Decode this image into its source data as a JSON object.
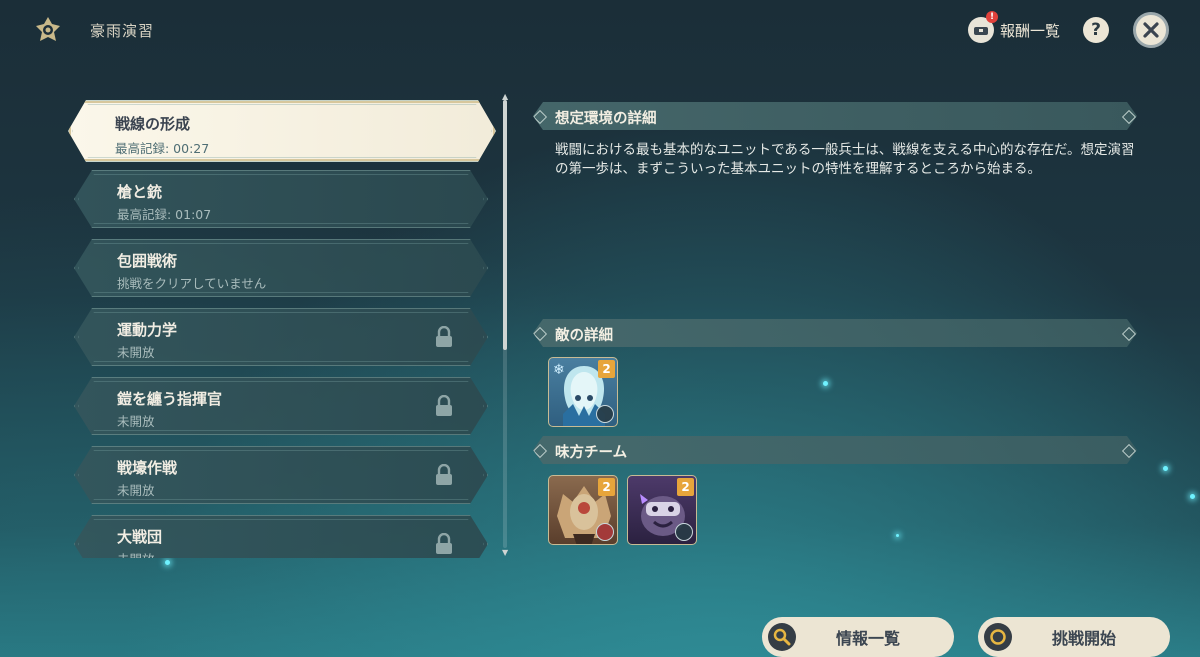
{
  "header": {
    "title": "豪雨演習",
    "rewards_label": "報酬一覧",
    "rewards_badge": "!",
    "help_label": "?"
  },
  "challenges": [
    {
      "name": "戦線の形成",
      "sub": "最高記録: 00:27",
      "state": "active"
    },
    {
      "name": "槍と銃",
      "sub": "最高記録: 01:07",
      "state": "cleared"
    },
    {
      "name": "包囲戦術",
      "sub": "挑戦をクリアしていません",
      "state": "open"
    },
    {
      "name": "運動力学",
      "sub": "未開放",
      "state": "locked"
    },
    {
      "name": "鎧を纏う指揮官",
      "sub": "未開放",
      "state": "locked"
    },
    {
      "name": "戦壕作戦",
      "sub": "未開放",
      "state": "locked"
    },
    {
      "name": "大戦団",
      "sub": "未開放",
      "state": "locked"
    }
  ],
  "details": {
    "env_heading": "想定環境の詳細",
    "env_text": "戦闘における最も基本的なユニットである一般兵士は、戦線を支える中心的な存在だ。想定演習の第一歩は、まずこういった基本ユニットの特性を理解するところから始まる。",
    "enemy_heading": "敵の詳細",
    "enemies": [
      {
        "icon": "cryo-slime-unit-icon",
        "level": "2"
      }
    ],
    "team_heading": "味方チーム",
    "allies": [
      {
        "icon": "hilichurl-shield-unit-icon",
        "level": "2"
      },
      {
        "icon": "electro-slime-unit-icon",
        "level": "2"
      }
    ]
  },
  "buttons": {
    "info_list": "情報一覧",
    "start": "挑戦開始"
  },
  "colors": {
    "accent_gold": "#e7a53b",
    "button_bg": "#ece5d3",
    "active_item_bg": "#fbf7ea"
  }
}
